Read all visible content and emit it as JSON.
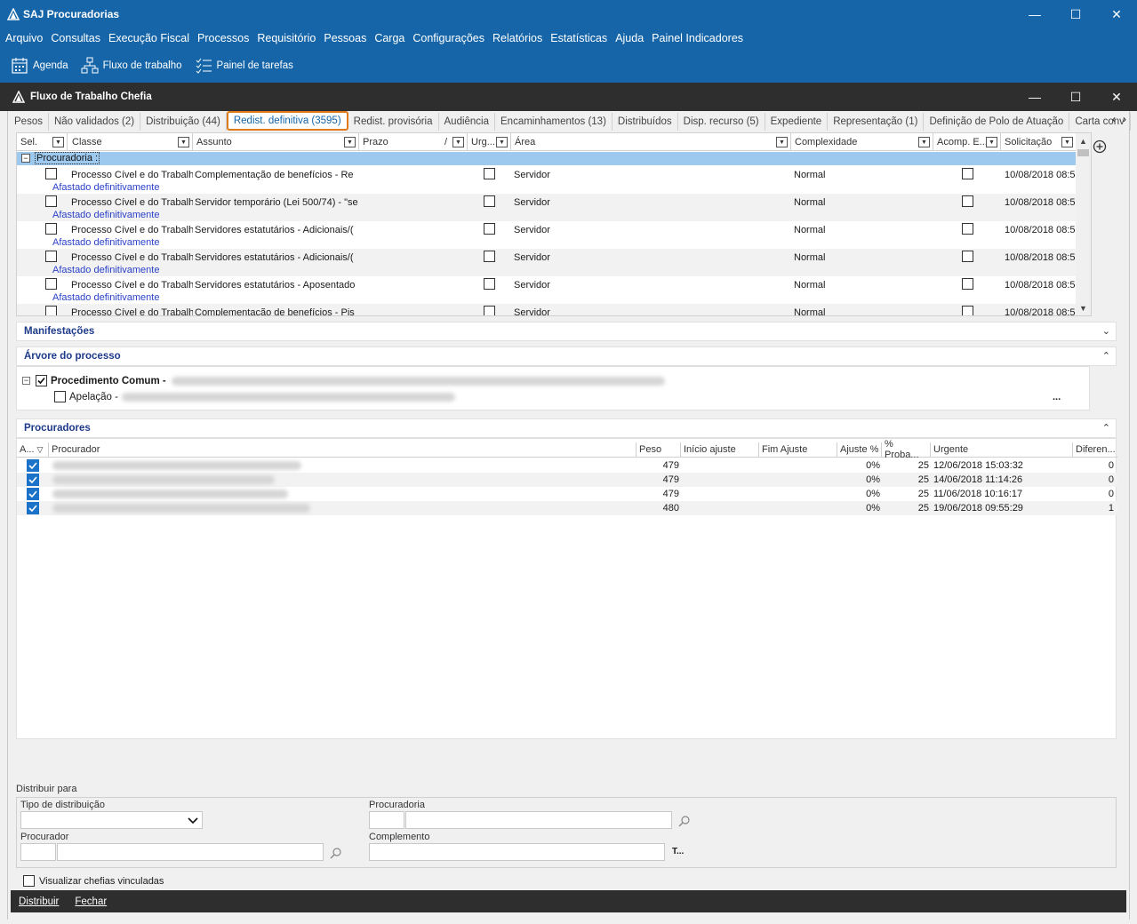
{
  "app": {
    "title": "SAJ Procuradorias",
    "win_min": "—",
    "win_max": "☐",
    "win_close": "✕"
  },
  "menu": [
    "Arquivo",
    "Consultas",
    "Execução Fiscal",
    "Processos",
    "Requisitório",
    "Pessoas",
    "Carga",
    "Configurações",
    "Relatórios",
    "Estatísticas",
    "Ajuda",
    "Painel Indicadores"
  ],
  "toolbar": {
    "agenda": "Agenda",
    "fluxo": "Fluxo de trabalho",
    "painel": "Painel de tarefas"
  },
  "window": {
    "title": "Fluxo de Trabalho Chefia"
  },
  "tabs": [
    "Pesos",
    "Não validados (2)",
    "Distribuição (44)",
    "Redist. definitiva (3595)",
    "Redist. provisória",
    "Audiência",
    "Encaminhamentos (13)",
    "Distribuídos",
    "Disp. recurso (5)",
    "Expediente",
    "Representação (1)",
    "Definição de Polo de Atuação",
    "Carta conv"
  ],
  "tab_scroll": {
    "left": "‹",
    "right": "›"
  },
  "grid": {
    "columns": [
      "Sel.",
      "Classe",
      "Assunto",
      "Prazo",
      "Urg...",
      "Área",
      "Complexidade",
      "Acomp. E...",
      "Solicitação"
    ],
    "prazo_slash": "/",
    "group_label": "Procuradoria :",
    "group_toggle": "−",
    "rows": [
      {
        "classe": "Processo Cível e do Trabalho",
        "assunto": "Complementação de benefícios - Re",
        "area": "Servidor",
        "complexidade": "Normal",
        "solicitacao": "10/08/2018 08:5",
        "sub": "Afastado definitivamente"
      },
      {
        "classe": "Processo Cível e do Trabalho",
        "assunto": "Servidor temporário (Lei 500/74) - \"se",
        "area": "Servidor",
        "complexidade": "Normal",
        "solicitacao": "10/08/2018 08:5",
        "sub": "Afastado definitivamente"
      },
      {
        "classe": "Processo Cível e do Trabalho",
        "assunto": "Servidores estatutários - Adicionais/(",
        "area": "Servidor",
        "complexidade": "Normal",
        "solicitacao": "10/08/2018 08:5",
        "sub": "Afastado definitivamente"
      },
      {
        "classe": "Processo Cível e do Trabalho",
        "assunto": "Servidores estatutários - Adicionais/(",
        "area": "Servidor",
        "complexidade": "Normal",
        "solicitacao": "10/08/2018 08:5",
        "sub": "Afastado definitivamente"
      },
      {
        "classe": "Processo Cível e do Trabalho",
        "assunto": "Servidores estatutários - Aposentado",
        "area": "Servidor",
        "complexidade": "Normal",
        "solicitacao": "10/08/2018 08:5",
        "sub": "Afastado definitivamente"
      },
      {
        "classe": "Processo Cível e do Trabalho",
        "assunto": "Complementação de benefícios - Pis",
        "area": "Servidor",
        "complexidade": "Normal",
        "solicitacao": "10/08/2018 08:5",
        "sub": ""
      }
    ]
  },
  "sections": {
    "manifestacoes": "Manifestações",
    "arvore": "Árvore do processo",
    "procuradores": "Procuradores",
    "chev_down": "⌄",
    "chev_up": "⌃"
  },
  "tree": {
    "toggle": "−",
    "root": "Procedimento Comum -",
    "child": "Apelação -",
    "more": "..."
  },
  "procuradores": {
    "columns": [
      "A...",
      "Procurador",
      "Peso",
      "Início ajuste",
      "Fim Ajuste",
      "Ajuste %",
      "% Proba...",
      "Urgente",
      "Diferen..."
    ],
    "rows": [
      {
        "peso": "479",
        "ajuste": "0%",
        "proba": "25",
        "urgente": "12/06/2018 15:03:32",
        "diferenca": "0"
      },
      {
        "peso": "479",
        "ajuste": "0%",
        "proba": "25",
        "urgente": "14/06/2018 11:14:26",
        "diferenca": "0"
      },
      {
        "peso": "479",
        "ajuste": "0%",
        "proba": "25",
        "urgente": "11/06/2018 10:16:17",
        "diferenca": "0"
      },
      {
        "peso": "480",
        "ajuste": "0%",
        "proba": "25",
        "urgente": "19/06/2018 09:55:29",
        "diferenca": "1"
      }
    ]
  },
  "distribuir": {
    "legend": "Distribuir para",
    "tipo_label": "Tipo de distribuição",
    "procuradoria_label": "Procuradoria",
    "procurador_label": "Procurador",
    "complemento_label": "Complemento",
    "tipo_value": "",
    "complemento_btn": "T..."
  },
  "visualizar": "Visualizar chefias vinculadas",
  "bottom": {
    "distribuir": "Distribuir",
    "fechar": "Fechar"
  }
}
